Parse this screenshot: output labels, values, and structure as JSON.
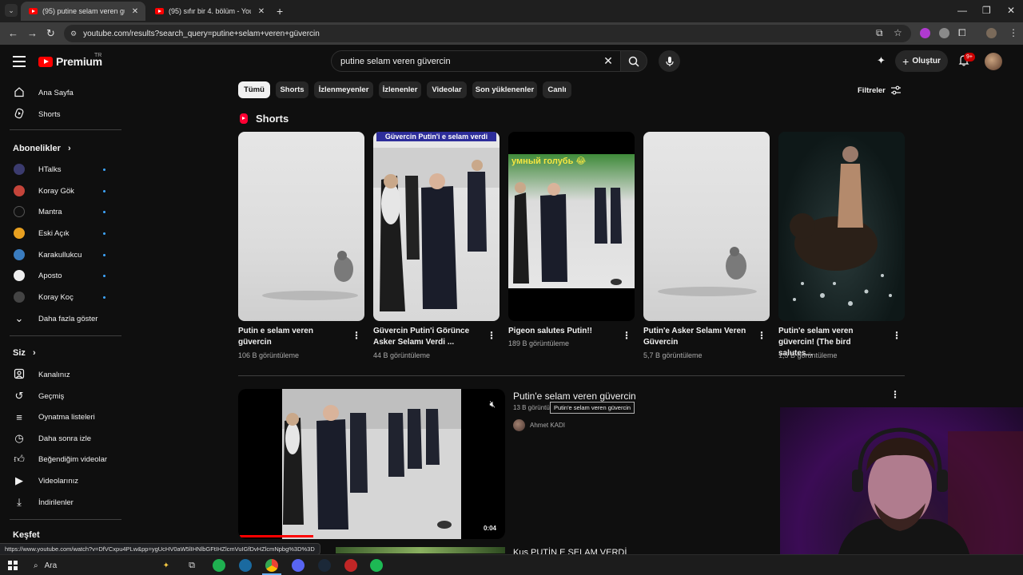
{
  "browser": {
    "tabs": [
      {
        "title": "(95) putine selam veren güvercin - YouTube",
        "active": true
      },
      {
        "title": "(95) sıfır bir 4. bölüm - YouTube",
        "active": false
      }
    ],
    "url": "youtube.com/results?search_query=putine+selam+veren+güvercin"
  },
  "header": {
    "logo_text": "Premium",
    "region": "TR",
    "search_value": "putine selam veren güvercin",
    "create_label": "Oluştur",
    "notif_badge": "9+"
  },
  "sidebar": {
    "main": [
      {
        "icon": "home-icon",
        "label": "Ana Sayfa"
      },
      {
        "icon": "shorts-icon",
        "label": "Shorts"
      }
    ],
    "subscriptions_title": "Abonelikler",
    "subscriptions": [
      {
        "label": "HTalks",
        "color": "#3b3b6e"
      },
      {
        "label": "Koray Gök",
        "color": "#c4443a"
      },
      {
        "label": "Mantra",
        "color": "#111111"
      },
      {
        "label": "Eski Açık",
        "color": "#e8a020"
      },
      {
        "label": "Karakullukcu",
        "color": "#3a7cbf"
      },
      {
        "label": "Aposto",
        "color": "#eeeeee"
      },
      {
        "label": "Koray Koç",
        "color": "#444444"
      }
    ],
    "show_more": "Daha fazla göster",
    "you_title": "Siz",
    "you_items": [
      {
        "icon": "channel-icon",
        "label": "Kanalınız"
      },
      {
        "icon": "history-icon",
        "label": "Geçmiş"
      },
      {
        "icon": "playlists-icon",
        "label": "Oynatma listeleri"
      },
      {
        "icon": "watch-later-icon",
        "label": "Daha sonra izle"
      },
      {
        "icon": "liked-icon",
        "label": "Beğendiğim videolar"
      },
      {
        "icon": "your-videos-icon",
        "label": "Videolarınız"
      },
      {
        "icon": "downloads-icon",
        "label": "İndirilenler"
      }
    ],
    "explore_title": "Keşfet"
  },
  "chips": [
    "Tümü",
    "Shorts",
    "İzlenmeyenler",
    "İzlenenler",
    "Videolar",
    "Son yüklenenler",
    "Canlı"
  ],
  "filters_label": "Filtreler",
  "shorts": {
    "title": "Shorts",
    "items": [
      {
        "title": "Putin e selam veren güvercin",
        "views": "106 B görüntüleme",
        "overlay": ""
      },
      {
        "title": "Güvercin Putin'i Görünce Asker Selamı Verdi ...",
        "views": "44 B görüntüleme",
        "overlay": "Güvercin Putin'i e selam verdi"
      },
      {
        "title": "Pigeon salutes Putin!!",
        "views": "189 B görüntüleme",
        "overlay": "умный голубь 😂"
      },
      {
        "title": "Putin'e Asker Selamı Veren Güvercin",
        "views": "5,7 B görüntüleme",
        "overlay": ""
      },
      {
        "title": "Putin'e selam veren güvercin! (The bird salutes...",
        "views": "1,5 B görüntüleme",
        "overlay": ""
      }
    ]
  },
  "video": {
    "title": "Putin'e selam veren güvercin",
    "meta": "13 B görüntüleme",
    "tooltip": "Putin'e selam veren güvercin",
    "channel": "Ahmet KADI",
    "duration": "0:04",
    "progress": 0.28
  },
  "next_video_title": "Kuş PUTİN E SELAM VERDİ",
  "status_url": "https://www.youtube.com/watch?v=DfVCxpu4PLw&pp=ygUcHV0aW5lIHNlbGFtIHZlcmVuIGfDvHZlcmNpbg%3D%3D",
  "taskbar": {
    "search_label": "Ara"
  }
}
